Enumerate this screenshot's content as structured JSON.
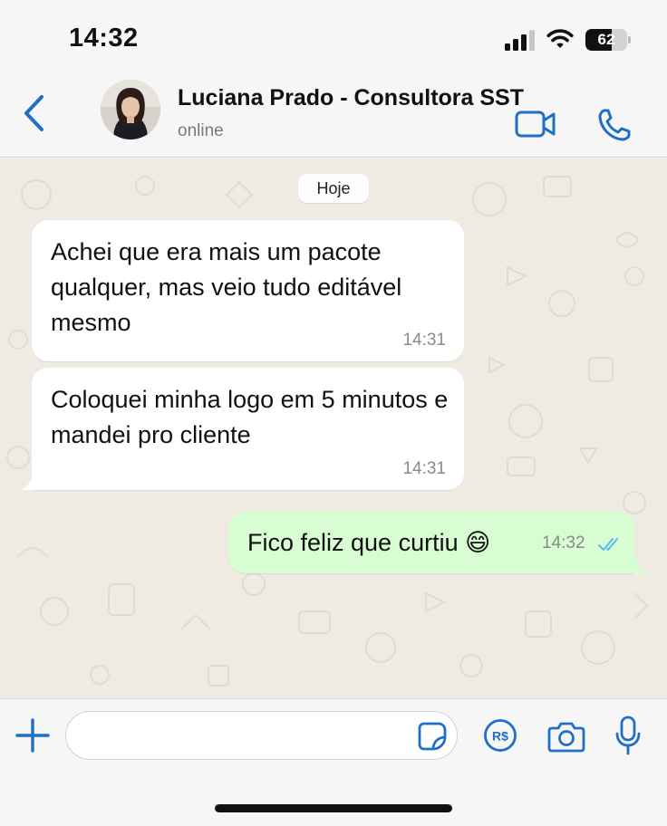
{
  "status_bar": {
    "time": "14:32",
    "battery_level": "62",
    "battery_fraction": 0.62,
    "icons": [
      "signal-icon",
      "wifi-icon",
      "battery-icon"
    ]
  },
  "header": {
    "back_icon": "chevron-left-icon",
    "contact_name": "Luciana Prado - Consultora SST",
    "status": "online",
    "video_icon": "video-call-icon",
    "call_icon": "phone-icon"
  },
  "chat": {
    "date_label": "Hoje",
    "messages": [
      {
        "direction": "incoming",
        "text": "Achei que era mais um pacote qualquer, mas veio tudo editável mesmo",
        "time": "14:31"
      },
      {
        "direction": "incoming",
        "text": "Coloquei minha logo em 5 minutos e mandei pro cliente",
        "time": "14:31"
      },
      {
        "direction": "outgoing",
        "text": "Fico feliz que curtiu 😄",
        "time": "14:32",
        "read": true
      }
    ]
  },
  "input_bar": {
    "plus_icon": "plus-icon",
    "message_placeholder": "",
    "sticker_icon": "sticker-icon",
    "payment_icon": "pix-payment-icon",
    "camera_icon": "camera-icon",
    "mic_icon": "microphone-icon"
  },
  "colors": {
    "accent": "#1f6fc4",
    "incoming_bubble": "#ffffff",
    "outgoing_bubble": "#d9fdd3",
    "wallpaper": "#efeae2",
    "read_ticks": "#53bdeb"
  }
}
